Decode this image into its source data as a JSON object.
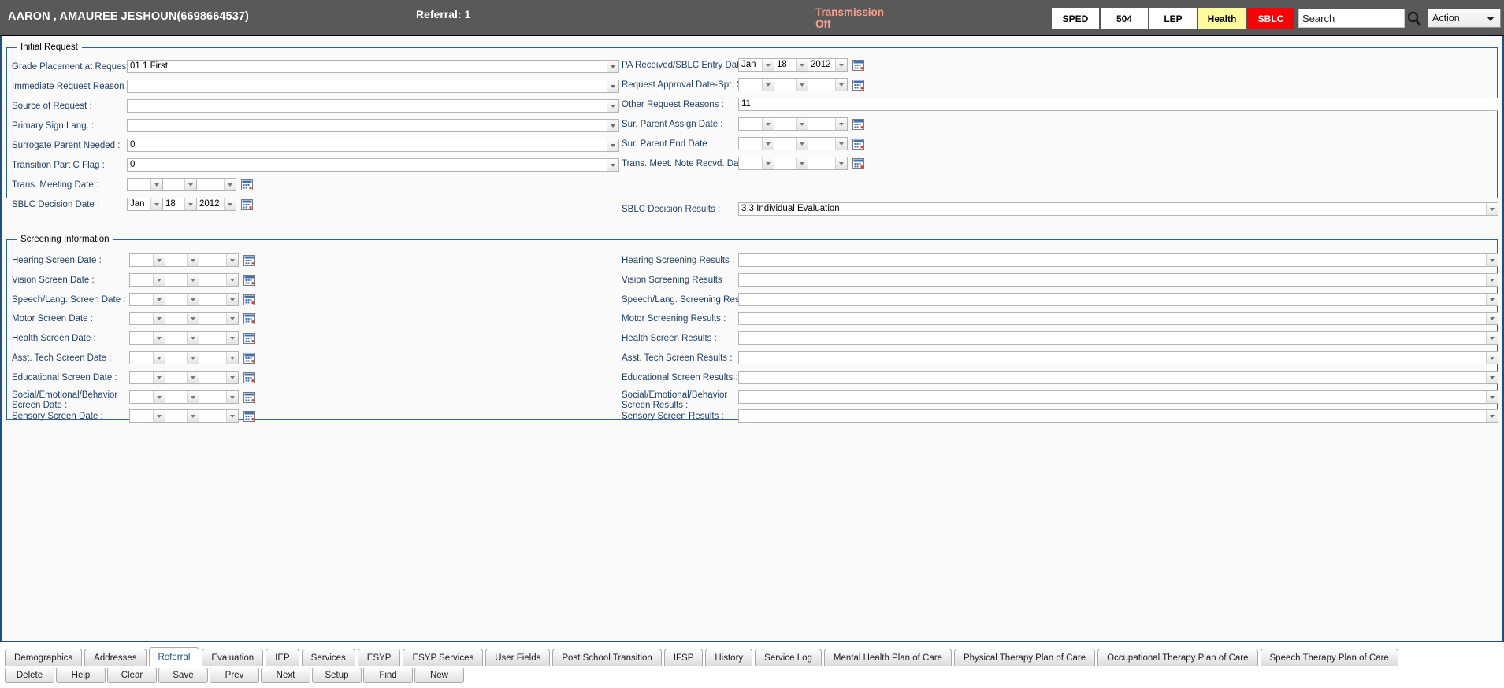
{
  "header": {
    "student_name": "AARON , AMAUREE JESHOUN(6698664537)",
    "referral_label": "Referral: 1",
    "transmission_status": "Transmission Off",
    "program_buttons": [
      {
        "label": "SPED",
        "style": "white"
      },
      {
        "label": "504",
        "style": "white"
      },
      {
        "label": "LEP",
        "style": "white"
      },
      {
        "label": "Health",
        "style": "yellow"
      },
      {
        "label": "SBLC",
        "style": "red"
      }
    ],
    "search": {
      "value": "Search",
      "placeholder": "Search"
    },
    "action_select": {
      "selected": "Action"
    },
    "colors": {
      "bar_background": "#595959",
      "transmission_text": "#f4a08a",
      "health_button": "#fdfb9b",
      "sblc_button": "#fb0006",
      "section_border": "#2f5f9e",
      "label_text": "#1f3f66"
    }
  },
  "initial_request": {
    "legend": "Initial Request",
    "left_fields": [
      {
        "label": "Grade Placement at Request :",
        "type": "select",
        "value": "01 1 First"
      },
      {
        "label": "Immediate Request Reason :",
        "type": "select",
        "value": ""
      },
      {
        "label": "Source of Request :",
        "type": "select",
        "value": ""
      },
      {
        "label": "Primary Sign Lang. :",
        "type": "select",
        "value": ""
      },
      {
        "label": "Surrogate Parent Needed :",
        "type": "select",
        "value": "0"
      },
      {
        "label": "Transition Part C Flag :",
        "type": "select",
        "value": "0"
      },
      {
        "label": "Trans. Meeting Date :",
        "type": "date",
        "month": "",
        "day": "",
        "year": ""
      },
      {
        "label": "SBLC Decision Date :",
        "type": "date",
        "month": "Jan",
        "day": "18",
        "year": "2012"
      }
    ],
    "right_fields": [
      {
        "label": "PA Received/SBLC Entry Date :",
        "type": "date",
        "month": "Jan",
        "day": "18",
        "year": "2012"
      },
      {
        "label": "Request Approval Date-Spt. Serv. :",
        "type": "date",
        "month": "",
        "day": "",
        "year": ""
      },
      {
        "label": "Other Request Reasons :",
        "type": "text",
        "value": "11"
      },
      {
        "label": "Sur. Parent Assign Date :",
        "type": "date",
        "month": "",
        "day": "",
        "year": ""
      },
      {
        "label": "Sur. Parent End Date :",
        "type": "date",
        "month": "",
        "day": "",
        "year": ""
      },
      {
        "label": "Trans. Meet. Note Recvd. Date :",
        "type": "date",
        "month": "",
        "day": "",
        "year": ""
      },
      {
        "label": "SBLC Decision Results :",
        "type": "select",
        "value": "3 3 Individual Evaluation"
      }
    ]
  },
  "screening_information": {
    "legend": "Screening Information",
    "date_fields": [
      {
        "label": "Hearing Screen Date :",
        "month": "",
        "day": "",
        "year": ""
      },
      {
        "label": "Vision Screen Date :",
        "month": "",
        "day": "",
        "year": ""
      },
      {
        "label": "Speech/Lang. Screen Date :",
        "month": "",
        "day": "",
        "year": ""
      },
      {
        "label": "Motor Screen Date :",
        "month": "",
        "day": "",
        "year": ""
      },
      {
        "label": "Health Screen Date :",
        "month": "",
        "day": "",
        "year": ""
      },
      {
        "label": "Asst. Tech Screen Date :",
        "month": "",
        "day": "",
        "year": ""
      },
      {
        "label": "Educational Screen Date :",
        "month": "",
        "day": "",
        "year": ""
      },
      {
        "label": "Social/Emotional/Behavior Screen Date :",
        "month": "",
        "day": "",
        "year": ""
      },
      {
        "label": "Sensory Screen Date :",
        "month": "",
        "day": "",
        "year": ""
      }
    ],
    "result_fields": [
      {
        "label": "Hearing Screening Results :",
        "value": ""
      },
      {
        "label": "Vision Screening Results :",
        "value": ""
      },
      {
        "label": "Speech/Lang. Screening Results :",
        "value": ""
      },
      {
        "label": "Motor Screening Results :",
        "value": ""
      },
      {
        "label": "Health Screen Results :",
        "value": ""
      },
      {
        "label": "Asst. Tech Screen Results :",
        "value": ""
      },
      {
        "label": "Educational Screen Results :",
        "value": ""
      },
      {
        "label": "Social/Emotional/Behavior Screen Results :",
        "value": ""
      },
      {
        "label": "Sensory Screen Results :",
        "value": ""
      }
    ]
  },
  "tabs": [
    {
      "label": "Demographics",
      "active": false
    },
    {
      "label": "Addresses",
      "active": false
    },
    {
      "label": "Referral",
      "active": true
    },
    {
      "label": "Evaluation",
      "active": false
    },
    {
      "label": "IEP",
      "active": false
    },
    {
      "label": "Services",
      "active": false
    },
    {
      "label": "ESYP",
      "active": false
    },
    {
      "label": "ESYP Services",
      "active": false
    },
    {
      "label": "User Fields",
      "active": false
    },
    {
      "label": "Post School Transition",
      "active": false
    },
    {
      "label": "IFSP",
      "active": false
    },
    {
      "label": "History",
      "active": false
    },
    {
      "label": "Service Log",
      "active": false
    },
    {
      "label": "Mental Health Plan of Care",
      "active": false
    },
    {
      "label": "Physical Therapy Plan of Care",
      "active": false
    },
    {
      "label": "Occupational Therapy Plan of Care",
      "active": false
    },
    {
      "label": "Speech Therapy Plan of Care",
      "active": false
    }
  ],
  "action_buttons": [
    {
      "label": "Delete"
    },
    {
      "label": "Help"
    },
    {
      "label": "Clear"
    },
    {
      "label": "Save"
    },
    {
      "label": "Prev"
    },
    {
      "label": "Next"
    },
    {
      "label": "Setup"
    },
    {
      "label": "Find"
    },
    {
      "label": "New"
    }
  ]
}
